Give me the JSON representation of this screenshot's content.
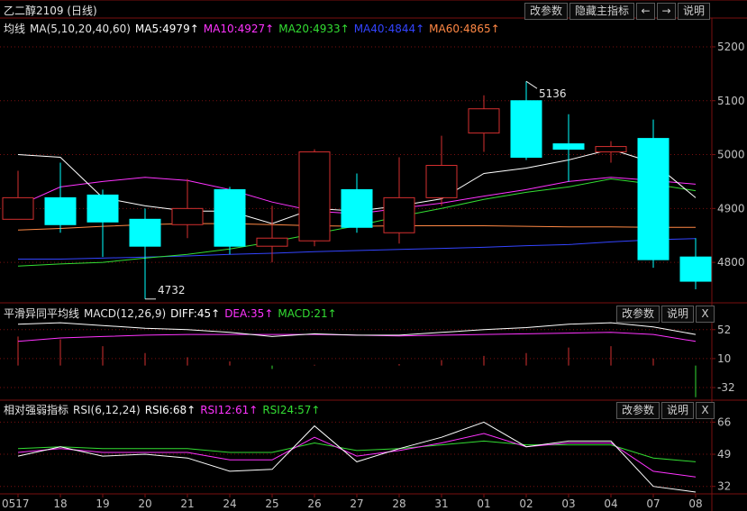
{
  "title": "乙二醇2109 (日线)",
  "toolbar": {
    "change_params": "改参数",
    "hide_main": "隐藏主指标",
    "prev": "←",
    "next": "→",
    "help": "说明"
  },
  "panel_buttons": {
    "change_params": "改参数",
    "help": "说明",
    "close": "X"
  },
  "legends": {
    "ma": {
      "name": "均线",
      "formula": "MA(5,10,20,40,60)",
      "ma5": "MA5:4979↑",
      "ma10": "MA10:4927↑",
      "ma20": "MA20:4933↑",
      "ma40": "MA40:4844↑",
      "ma60": "MA60:4865↑"
    },
    "macd": {
      "name": "平滑异同平均线",
      "formula": "MACD(12,26,9)",
      "diff": "DIFF:45↑",
      "dea": "DEA:35↑",
      "macd": "MACD:21↑"
    },
    "rsi": {
      "name": "相对强弱指标",
      "formula": "RSI(6,12,24)",
      "rsi6": "RSI6:68↑",
      "rsi12": "RSI12:61↑",
      "rsi24": "RSI24:57↑"
    }
  },
  "colors": {
    "up": "#d32f2f",
    "down": "#00ffff",
    "ma5": "#ffffff",
    "ma10": "#ff33ff",
    "ma20": "#33dd33",
    "ma40": "#3344ff",
    "ma60": "#ff8844",
    "grid": "#7a1010"
  },
  "chart_data": [
    {
      "type": "candlestick",
      "x": [
        "0517",
        "18",
        "19",
        "20",
        "21",
        "24",
        "25",
        "26",
        "27",
        "28",
        "31",
        "01",
        "02",
        "03",
        "04",
        "07",
        "08"
      ],
      "ohlc": [
        [
          4880,
          4970,
          4880,
          4920
        ],
        [
          4920,
          4985,
          4855,
          4870
        ],
        [
          4925,
          4935,
          4810,
          4875
        ],
        [
          4880,
          4900,
          4732,
          4830
        ],
        [
          4870,
          4955,
          4845,
          4900
        ],
        [
          4935,
          4940,
          4815,
          4830
        ],
        [
          4830,
          4905,
          4800,
          4845
        ],
        [
          4840,
          5010,
          4830,
          5005
        ],
        [
          4935,
          4965,
          4855,
          4865
        ],
        [
          4855,
          4995,
          4835,
          4920
        ],
        [
          4920,
          5035,
          4905,
          4980
        ],
        [
          5040,
          5110,
          5005,
          5085
        ],
        [
          5100,
          5136,
          4990,
          4995
        ],
        [
          5020,
          5075,
          4950,
          5010
        ],
        [
          5005,
          5025,
          4985,
          5015
        ],
        [
          5030,
          5065,
          4790,
          4805
        ],
        [
          4810,
          4845,
          4750,
          4765
        ]
      ],
      "annotations": [
        {
          "text": "4732"
        },
        {
          "text": "5136"
        }
      ],
      "ma5": [
        5000,
        4995,
        4920,
        4905,
        4895,
        4895,
        4872,
        4900,
        4895,
        4905,
        4918,
        4965,
        4975,
        4990,
        5010,
        4985,
        4920
      ],
      "ma10": [
        4905,
        4940,
        4950,
        4958,
        4952,
        4935,
        4912,
        4895,
        4890,
        4900,
        4910,
        4923,
        4935,
        4950,
        4958,
        4952,
        4945
      ],
      "ma20": [
        4793,
        4797,
        4800,
        4808,
        4815,
        4825,
        4838,
        4853,
        4868,
        4885,
        4900,
        4917,
        4930,
        4940,
        4955,
        4945,
        4933
      ],
      "ma40": [
        4806,
        4806,
        4808,
        4810,
        4812,
        4815,
        4817,
        4820,
        4822,
        4824,
        4826,
        4828,
        4831,
        4833,
        4838,
        4842,
        4844
      ],
      "ma60": [
        4860,
        4863,
        4867,
        4870,
        4872,
        4872,
        4870,
        4868,
        4867,
        4868,
        4868,
        4868,
        4867,
        4866,
        4866,
        4865,
        4865
      ],
      "yticks": [
        5200,
        5100,
        5000,
        4900,
        4800
      ],
      "ylim": [
        4735,
        5220
      ]
    },
    {
      "type": "macd",
      "diff": [
        60,
        62,
        58,
        54,
        52,
        48,
        42,
        46,
        44,
        44,
        48,
        52,
        55,
        60,
        62,
        56,
        45
      ],
      "dea": [
        35,
        40,
        42,
        44,
        45,
        45,
        45,
        45,
        44,
        43,
        44,
        45,
        46,
        47,
        48,
        45,
        35
      ],
      "macd": [
        42,
        38,
        28,
        18,
        12,
        6,
        -5,
        1,
        0,
        2,
        8,
        14,
        18,
        26,
        28,
        10,
        -46
      ],
      "yticks": [
        52,
        10,
        -32
      ],
      "ylim": [
        -45,
        70
      ]
    },
    {
      "type": "rsi",
      "rsi6": [
        48,
        53,
        48,
        49,
        47,
        40,
        41,
        64,
        45,
        52,
        58,
        66,
        53,
        56,
        56,
        32,
        29
      ],
      "rsi12": [
        50,
        52,
        50,
        50,
        50,
        46,
        46,
        58,
        48,
        51,
        55,
        60,
        53,
        55,
        55,
        40,
        37
      ],
      "rsi24": [
        52,
        53,
        52,
        52,
        52,
        50,
        50,
        55,
        51,
        52,
        54,
        56,
        54,
        54,
        54,
        47,
        45
      ],
      "yticks": [
        66,
        49,
        32
      ],
      "ylim": [
        29,
        70
      ]
    }
  ]
}
